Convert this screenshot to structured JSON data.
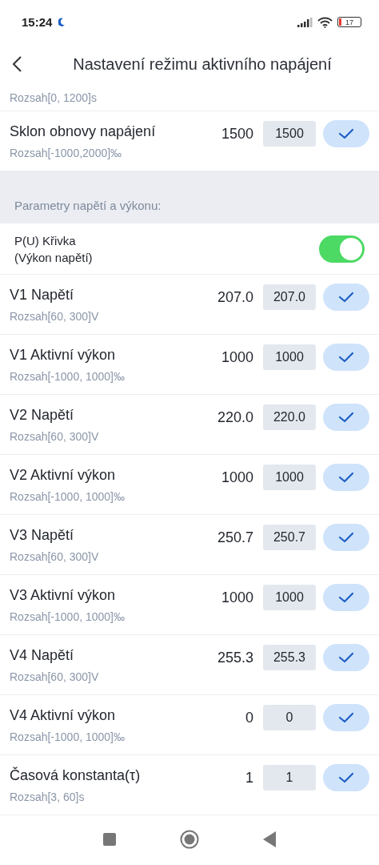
{
  "status_bar": {
    "time": "15:24",
    "battery": "17"
  },
  "header": {
    "title": "Nastavení režimu aktivního napájení"
  },
  "partial_row": {
    "range": "Rozsah[0, 1200]s"
  },
  "top_rows": [
    {
      "label": "Sklon obnovy napájení",
      "range": "Rozsah[-1000,2000]‰",
      "current": "1500",
      "value": "1500"
    }
  ],
  "section": {
    "title": "Parametry napětí a výkonu:"
  },
  "toggle": {
    "label_line1": "P(U) Křivka",
    "label_line2": "(Výkon napětí)",
    "on": true
  },
  "rows": [
    {
      "label": "V1 Napětí",
      "range": "Rozsah[60, 300]V",
      "current": "207.0",
      "value": "207.0"
    },
    {
      "label": "V1 Aktivní výkon",
      "range": "Rozsah[-1000, 1000]‰",
      "current": "1000",
      "value": "1000"
    },
    {
      "label": "V2 Napětí",
      "range": "Rozsah[60, 300]V",
      "current": "220.0",
      "value": "220.0"
    },
    {
      "label": "V2 Aktivní výkon",
      "range": "Rozsah[-1000, 1000]‰",
      "current": "1000",
      "value": "1000"
    },
    {
      "label": "V3 Napětí",
      "range": "Rozsah[60, 300]V",
      "current": "250.7",
      "value": "250.7"
    },
    {
      "label": "V3 Aktivní výkon",
      "range": "Rozsah[-1000, 1000]‰",
      "current": "1000",
      "value": "1000"
    },
    {
      "label": "V4 Napětí",
      "range": "Rozsah[60, 300]V",
      "current": "255.3",
      "value": "255.3"
    },
    {
      "label": "V4 Aktivní výkon",
      "range": "Rozsah[-1000, 1000]‰",
      "current": "0",
      "value": "0"
    },
    {
      "label": "Časová konstanta(τ)",
      "range": "Rozsah[3, 60]s",
      "current": "1",
      "value": "1"
    }
  ]
}
